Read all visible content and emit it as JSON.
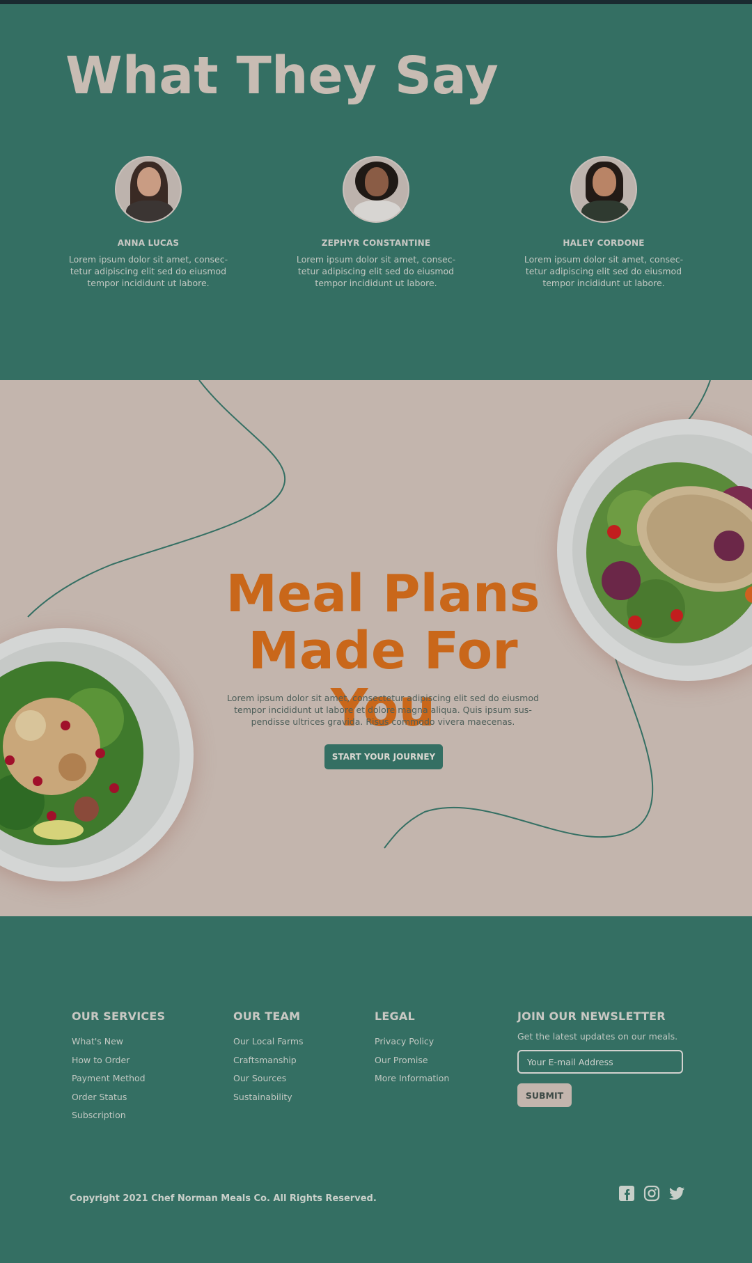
{
  "testimonials": {
    "title": "What They Say",
    "people": [
      {
        "name": "ANNA LUCAS",
        "quote": "Lorem ipsum dolor sit amet, consec-tetur adipiscing elit sed do eiusmod tempor incididunt ut labore."
      },
      {
        "name": "ZEPHYR CONSTANTINE",
        "quote": "Lorem ipsum dolor sit amet, consec-tetur adipiscing elit sed do eiusmod tempor incididunt ut labore."
      },
      {
        "name": "HALEY CORDONE",
        "quote": "Lorem ipsum dolor sit amet, consec-tetur adipiscing elit sed do eiusmod tempor incididunt ut labore."
      }
    ]
  },
  "hero": {
    "title_line1": "Meal Plans",
    "title_line2": "Made For You",
    "text": "Lorem ipsum dolor sit amet, consectetur adipiscing elit sed do eiusmod tempor incididunt ut labore et dolore magna aliqua. Quis ipsum sus-pendisse ultrices gravida. Risus commodo vivera maecenas.",
    "cta_label": "START YOUR JOURNEY"
  },
  "footer": {
    "services": {
      "title": "OUR SERVICES",
      "links": [
        "What's New",
        "How to Order",
        "Payment Method",
        "Order Status",
        "Subscription"
      ]
    },
    "team": {
      "title": "OUR TEAM",
      "links": [
        "Our Local Farms",
        "Craftsmanship",
        "Our Sources",
        "Sustainability"
      ]
    },
    "legal": {
      "title": "LEGAL",
      "links": [
        "Privacy Policy",
        "Our Promise",
        "More Information"
      ]
    },
    "newsletter": {
      "title": "JOIN OUR NEWSLETTER",
      "description": "Get the latest updates on our meals.",
      "placeholder": "Your E-mail Address",
      "submit_label": "SUBMIT"
    },
    "copyright": "Copyright 2021 Chef Norman Meals Co. All Rights Reserved.",
    "social_icons": [
      "facebook-icon",
      "instagram-icon",
      "twitter-icon"
    ]
  },
  "colors": {
    "teal": "#346f63",
    "beige": "#c3b5ad",
    "orange": "#c9671a",
    "heading_light": "#c8bcb3"
  }
}
